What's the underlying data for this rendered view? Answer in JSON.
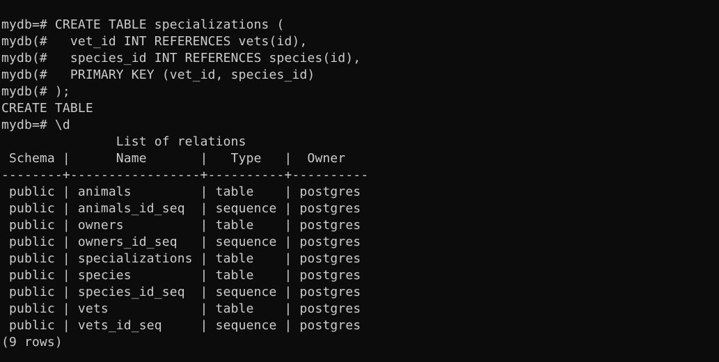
{
  "terminal": {
    "lines": [
      "mydb=# CREATE TABLE specializations (",
      "mydb(#   vet_id INT REFERENCES vets(id),",
      "mydb(#   species_id INT REFERENCES species(id),",
      "mydb(#   PRIMARY KEY (vet_id, species_id)",
      "mydb(# );",
      "CREATE TABLE",
      "mydb=# \\d",
      "               List of relations",
      " Schema |      Name       |   Type   |  Owner",
      "--------+-----------------+----------+----------",
      " public | animals         | table    | postgres",
      " public | animals_id_seq  | sequence | postgres",
      " public | owners          | table    | postgres",
      " public | owners_id_seq   | sequence | postgres",
      " public | specializations | table    | postgres",
      " public | species         | table    | postgres",
      " public | species_id_seq  | sequence | postgres",
      " public | vets            | table    | postgres",
      " public | vets_id_seq     | sequence | postgres",
      "(9 rows)"
    ]
  },
  "colors": {
    "background": "#0c0c0c",
    "foreground": "#cccccc"
  }
}
